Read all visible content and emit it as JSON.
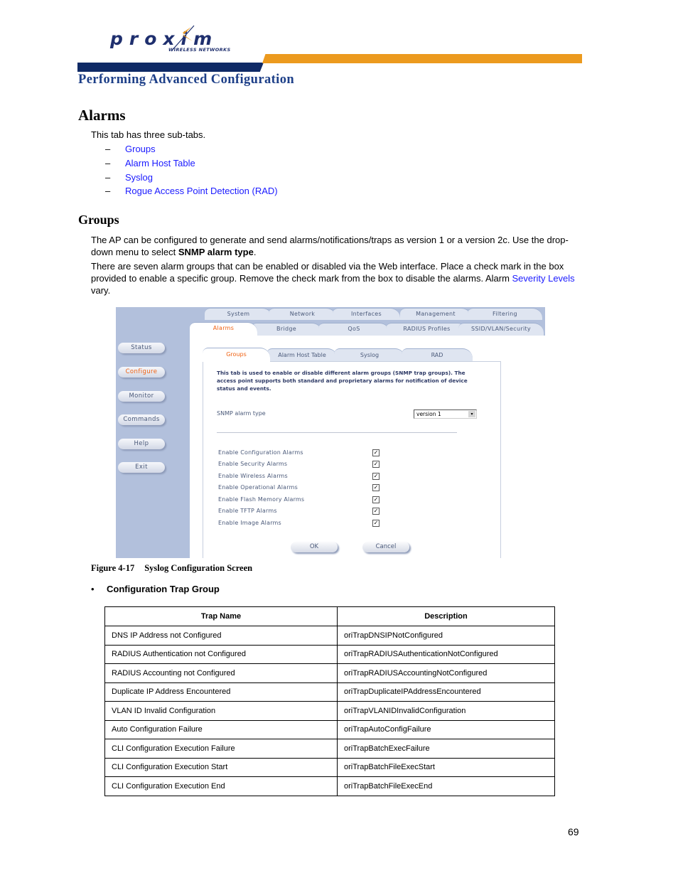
{
  "header": {
    "logo_word": "proxim",
    "logo_tagline": "WIRELESS NETWORKS",
    "section_title": "Performing Advanced Configuration",
    "colors": {
      "navy": "#0f2a66",
      "orange": "#ec9a1e",
      "title_blue": "#1d3f88",
      "link_blue": "#1a1aff"
    }
  },
  "alarms": {
    "heading": "Alarms",
    "intro": "This tab has three sub-tabs.",
    "subtabs": [
      {
        "dash": "–",
        "label": "Groups"
      },
      {
        "dash": "–",
        "label": "Alarm Host Table"
      },
      {
        "dash": "–",
        "label": "Syslog"
      },
      {
        "dash": "–",
        "label": "Rogue Access Point Detection (RAD)"
      }
    ]
  },
  "groups": {
    "heading": "Groups",
    "para1_pre": "The AP can be configured to generate and send alarms/notifications/traps as version 1 or a version 2c. Use the drop-down menu to select ",
    "para1_bold": "SNMP alarm type",
    "para1_post": ".",
    "para2_pre": "There are seven alarm groups that can be enabled or disabled via the Web interface. Place a check mark in the box provided to enable a specific group. Remove the check mark from the box to disable the alarms. Alarm ",
    "para2_link": "Severity Levels",
    "para2_post": " vary."
  },
  "figure": {
    "sidebar": [
      {
        "label": "Status",
        "active": false
      },
      {
        "label": "Configure",
        "active": true
      },
      {
        "label": "Monitor",
        "active": false
      },
      {
        "label": "Commands",
        "active": false
      },
      {
        "label": "Help",
        "active": false
      },
      {
        "label": "Exit",
        "active": false
      }
    ],
    "tabs_row1": [
      "System",
      "Network",
      "Interfaces",
      "Management",
      "Filtering"
    ],
    "tabs_row2": [
      "Alarms",
      "Bridge",
      "QoS",
      "RADIUS Profiles",
      "SSID/VLAN/Security"
    ],
    "active_tab": "Alarms",
    "subtabs": [
      "Groups",
      "Alarm Host Table",
      "Syslog",
      "RAD"
    ],
    "active_subtab": "Groups",
    "description": "This tab is used to enable or disable different alarm groups (SNMP trap groups). The access point supports both standard and proprietary alarms for notification of device status and events.",
    "snmp_label": "SNMP alarm type",
    "snmp_value": "version 1",
    "alarm_options": [
      {
        "label": "Enable Configuration Alarms",
        "checked": true
      },
      {
        "label": "Enable Security Alarms",
        "checked": true
      },
      {
        "label": "Enable Wireless Alarms",
        "checked": true
      },
      {
        "label": "Enable Operational Alarms",
        "checked": true
      },
      {
        "label": "Enable Flash Memory Alarms",
        "checked": true
      },
      {
        "label": "Enable TFTP Alarms",
        "checked": true
      },
      {
        "label": "Enable Image Alarms",
        "checked": true
      }
    ],
    "ok_label": "OK",
    "cancel_label": "Cancel",
    "check_glyph": "✓",
    "dropdown_glyph": "▾"
  },
  "caption": {
    "number": "Figure 4-17",
    "title": "Syslog Configuration Screen"
  },
  "trap_group": {
    "bullet": "•",
    "heading": "Configuration Trap Group",
    "columns": [
      "Trap Name",
      "Description"
    ],
    "rows": [
      [
        "DNS IP Address not Configured",
        "oriTrapDNSIPNotConfigured"
      ],
      [
        "RADIUS Authentication not Configured",
        "oriTrapRADIUSAuthenticationNotConfigured"
      ],
      [
        "RADIUS Accounting not Configured",
        "oriTrapRADIUSAccountingNotConfigured"
      ],
      [
        "Duplicate IP Address Encountered",
        "oriTrapDuplicateIPAddressEncountered"
      ],
      [
        "VLAN ID Invalid Configuration",
        "oriTrapVLANIDInvalidConfiguration"
      ],
      [
        "Auto Configuration Failure",
        "oriTrapAutoConfigFailure"
      ],
      [
        "CLI Configuration Execution Failure",
        "oriTrapBatchExecFailure"
      ],
      [
        "CLI Configuration Execution Start",
        "oriTrapBatchFileExecStart"
      ],
      [
        "CLI Configuration Execution End",
        "oriTrapBatchFileExecEnd"
      ]
    ]
  },
  "page_number": "69"
}
